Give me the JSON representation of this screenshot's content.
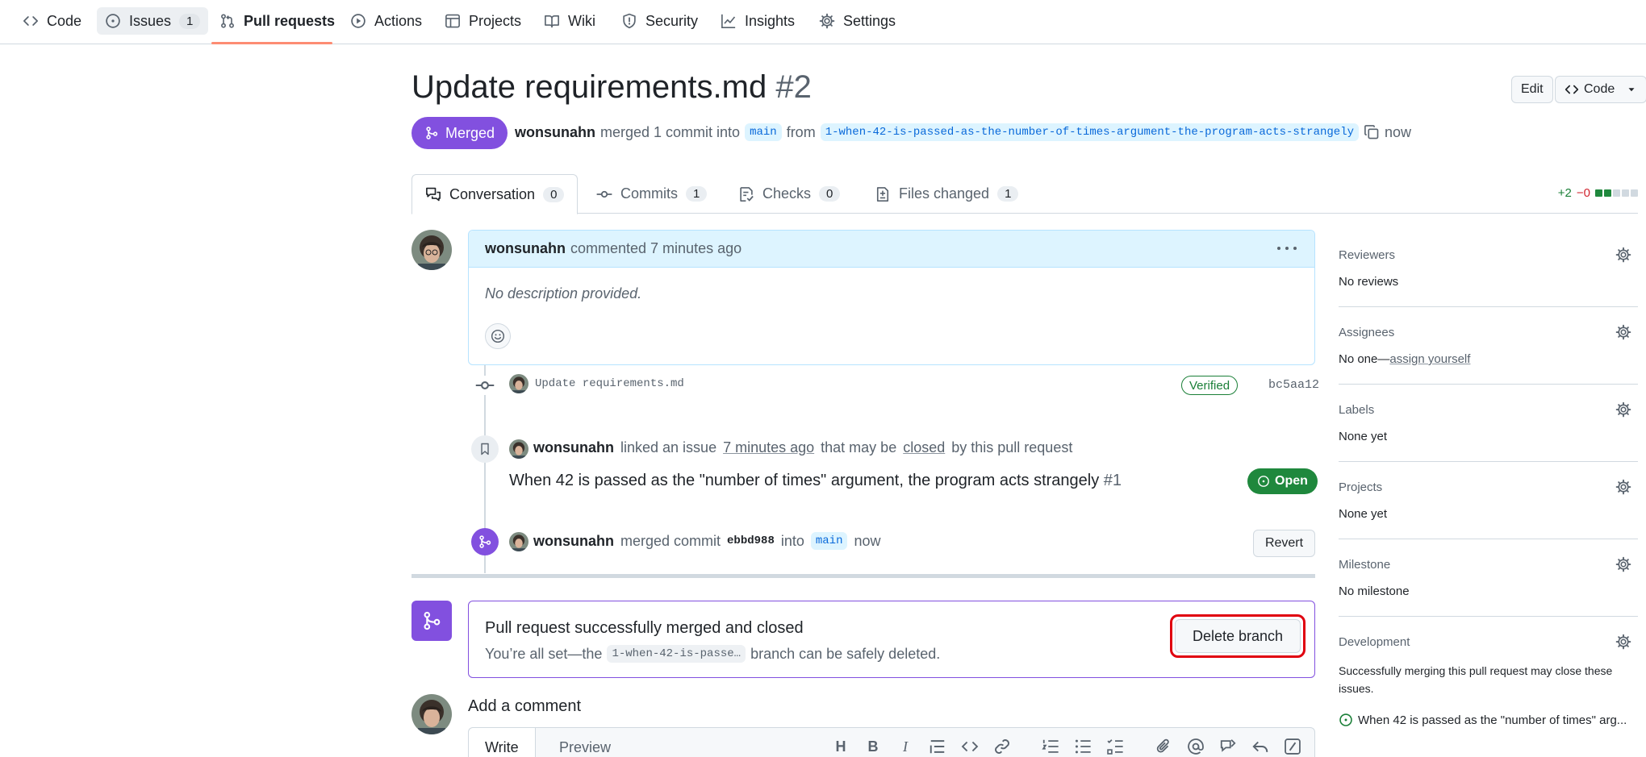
{
  "repo_nav": {
    "items": [
      {
        "label": "Code",
        "icon": "code-icon"
      },
      {
        "label": "Issues",
        "icon": "issue-opened-icon",
        "count": "1"
      },
      {
        "label": "Pull requests",
        "icon": "git-pull-request-icon"
      },
      {
        "label": "Actions",
        "icon": "play-icon"
      },
      {
        "label": "Projects",
        "icon": "table-icon"
      },
      {
        "label": "Wiki",
        "icon": "book-icon"
      },
      {
        "label": "Security",
        "icon": "shield-icon"
      },
      {
        "label": "Insights",
        "icon": "graph-icon"
      },
      {
        "label": "Settings",
        "icon": "gear-icon"
      }
    ],
    "active": "Pull requests"
  },
  "pr": {
    "title": "Update requirements.md",
    "number": "#2",
    "edit_label": "Edit",
    "code_label": "Code",
    "state": "Merged",
    "author": "wonsunahn",
    "action_text": "merged 1 commit into",
    "base_branch": "main",
    "from_text": "from",
    "head_branch": "1-when-42-is-passed-as-the-number-of-times-argument-the-program-acts-strangely",
    "time": "now"
  },
  "tabs": [
    {
      "label": "Conversation",
      "count": "0",
      "icon": "comment-discussion-icon"
    },
    {
      "label": "Commits",
      "count": "1",
      "icon": "git-commit-icon"
    },
    {
      "label": "Checks",
      "count": "0",
      "icon": "checklist-icon"
    },
    {
      "label": "Files changed",
      "count": "1",
      "icon": "file-diff-icon"
    }
  ],
  "diffstat": {
    "additions": "+2",
    "deletions": "−0"
  },
  "comment": {
    "author": "wonsunahn",
    "action": "commented 7 minutes ago",
    "body": "No description provided."
  },
  "timeline": {
    "commit": {
      "message": "Update requirements.md",
      "verified": "Verified",
      "sha": "bc5aa12"
    },
    "linked": {
      "author": "wonsunahn",
      "text_1": "linked an issue",
      "time": "7 minutes ago",
      "text_2": "that may be",
      "closed_word": "closed",
      "text_3": "by this pull request",
      "issue_title": "When 42 is passed as the \"number of times\" argument, the program acts strangely",
      "issue_number": "#1",
      "issue_state": "Open"
    },
    "merged": {
      "author": "wonsunahn",
      "text_1": "merged commit",
      "sha": "ebbd988",
      "text_2": "into",
      "branch": "main",
      "time": "now",
      "revert_label": "Revert"
    }
  },
  "merge_box": {
    "title": "Pull request successfully merged and closed",
    "sub_1": "You’re all set—the",
    "branch": "1-when-42-is-passe…",
    "sub_2": "branch can be safely deleted.",
    "delete_label": "Delete branch"
  },
  "add_comment": {
    "title": "Add a comment",
    "write_tab": "Write",
    "preview_tab": "Preview",
    "tools": [
      "H",
      "B",
      "I"
    ]
  },
  "sidebar": {
    "reviewers": {
      "title": "Reviewers",
      "value": "No reviews"
    },
    "assignees": {
      "title": "Assignees",
      "value": "No one—",
      "link": "assign yourself"
    },
    "labels": {
      "title": "Labels",
      "value": "None yet"
    },
    "projects": {
      "title": "Projects",
      "value": "None yet"
    },
    "milestone": {
      "title": "Milestone",
      "value": "No milestone"
    },
    "development": {
      "title": "Development",
      "desc": "Successfully merging this pull request may close these issues.",
      "issue": "When 42 is passed as the \"number of times\" arg..."
    }
  },
  "colors": {
    "merged_purple": "#8250df",
    "open_green": "#1f883d",
    "link_blue": "#0969da",
    "tab_underline": "#fd8c73",
    "highlight_ring": "#e0000f"
  }
}
